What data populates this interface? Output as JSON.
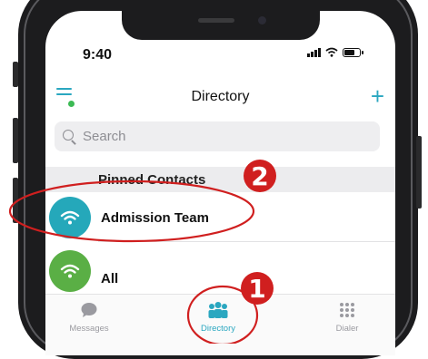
{
  "status_bar": {
    "time": "9:40"
  },
  "nav": {
    "title": "Directory"
  },
  "search": {
    "placeholder": "Search"
  },
  "section": {
    "title": "Pinned Contacts"
  },
  "contacts": [
    {
      "name": "Admission Team",
      "avatar_color": "#25a8ba"
    },
    {
      "name": "All",
      "avatar_color": "#5aaf45"
    }
  ],
  "tabs": [
    {
      "label": "Messages",
      "icon": "chat-bubble-icon"
    },
    {
      "label": "Directory",
      "icon": "people-icon",
      "active": true
    },
    {
      "label": "Dialer",
      "icon": "keypad-icon"
    }
  ],
  "annotations": [
    {
      "number": "1",
      "color": "#d01f1f"
    },
    {
      "number": "2",
      "color": "#d01f1f"
    }
  ],
  "colors": {
    "accent": "#2aa7c0",
    "annotation": "#d01f1f"
  }
}
